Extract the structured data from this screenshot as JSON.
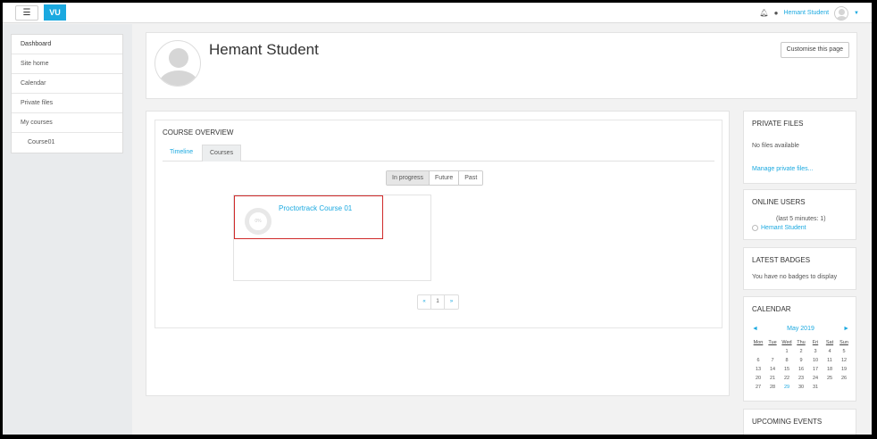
{
  "navbar": {
    "menu_icon": "hamburger-icon",
    "logo_text": "VU",
    "user_name": "Hemant Student",
    "icons": [
      "bell-icon",
      "chat-icon",
      "chevron-down-icon"
    ]
  },
  "drawer": {
    "items": [
      {
        "label": "Dashboard"
      },
      {
        "label": "Site home"
      },
      {
        "label": "Calendar"
      },
      {
        "label": "Private files"
      },
      {
        "label": "My courses"
      },
      {
        "label": "Course01"
      }
    ]
  },
  "header": {
    "title": "Hemant Student",
    "customise_label": "Customise this page"
  },
  "overview": {
    "title": "COURSE OVERVIEW",
    "tabs": [
      {
        "label": "Timeline"
      },
      {
        "label": "Courses"
      }
    ],
    "filters": [
      {
        "label": "In progress"
      },
      {
        "label": "Future"
      },
      {
        "label": "Past"
      }
    ],
    "course": {
      "name": "Proctortrack Course 01",
      "progress": "0%"
    },
    "pager": [
      "«",
      "1",
      "»"
    ]
  },
  "blocks": {
    "private_files": {
      "title": "PRIVATE FILES",
      "text": "No files available",
      "link": "Manage private files..."
    },
    "online_users": {
      "title": "ONLINE USERS",
      "text": "(last 5 minutes: 1)",
      "user": "Hemant Student"
    },
    "badges": {
      "title": "LATEST BADGES",
      "text": "You have no badges to display"
    },
    "calendar": {
      "title": "CALENDAR",
      "prev": "◄",
      "month": "May 2019",
      "next": "►",
      "days": [
        "Mon",
        "Tue",
        "Wed",
        "Thu",
        "Fri",
        "Sat",
        "Sun"
      ],
      "weeks": [
        [
          "",
          "",
          "1",
          "2",
          "3",
          "4",
          "5"
        ],
        [
          "6",
          "7",
          "8",
          "9",
          "10",
          "11",
          "12"
        ],
        [
          "13",
          "14",
          "15",
          "16",
          "17",
          "18",
          "19"
        ],
        [
          "20",
          "21",
          "22",
          "23",
          "24",
          "25",
          "26"
        ],
        [
          "27",
          "28",
          "29",
          "30",
          "31",
          "",
          ""
        ]
      ],
      "today": "29"
    },
    "upcoming": {
      "title": "UPCOMING EVENTS"
    }
  }
}
